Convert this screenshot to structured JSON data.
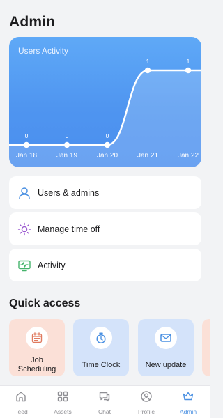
{
  "header": {
    "title": "Admin"
  },
  "chart_data": {
    "type": "line",
    "title": "Users Activity",
    "categories": [
      "Jan 18",
      "Jan 19",
      "Jan 20",
      "Jan 21",
      "Jan 22"
    ],
    "series": [
      {
        "values": [
          0,
          0,
          0,
          1,
          1
        ]
      }
    ],
    "data_labels": [
      "0",
      "0",
      "0",
      "1",
      "1"
    ],
    "ylim": [
      0,
      1
    ],
    "grid": false,
    "line_color": "#ffffff"
  },
  "menu": {
    "items": [
      {
        "label": "Users & admins",
        "icon": "users-icon",
        "color": "#4a90e2"
      },
      {
        "label": "Manage time off",
        "icon": "sun-icon",
        "color": "#9b59d0"
      },
      {
        "label": "Activity",
        "icon": "activity-monitor-icon",
        "color": "#45b36b"
      }
    ]
  },
  "quick_access": {
    "title": "Quick access",
    "items": [
      {
        "label": "Job Scheduling",
        "icon": "calendar-icon",
        "bg": "#fbe0d7",
        "icon_color": "#e07a5f"
      },
      {
        "label": "Time Clock",
        "icon": "stopwatch-icon",
        "bg": "#d4e3fa",
        "icon_color": "#4a90e2"
      },
      {
        "label": "New update",
        "icon": "envelope-icon",
        "bg": "#d4e3fa",
        "icon_color": "#4a90e2"
      },
      {
        "label": "",
        "icon": "",
        "bg": "#fbe0d7",
        "icon_color": "#e07a5f"
      }
    ]
  },
  "tabbar": {
    "tabs": [
      {
        "label": "Feed",
        "icon": "home-icon"
      },
      {
        "label": "Assets",
        "icon": "grid-icon"
      },
      {
        "label": "Chat",
        "icon": "chat-icon"
      },
      {
        "label": "Profile",
        "icon": "profile-icon"
      },
      {
        "label": "Admin",
        "icon": "crown-icon"
      }
    ],
    "active": "Admin",
    "active_color": "#4a90e2",
    "inactive_color": "#8e8e93"
  }
}
